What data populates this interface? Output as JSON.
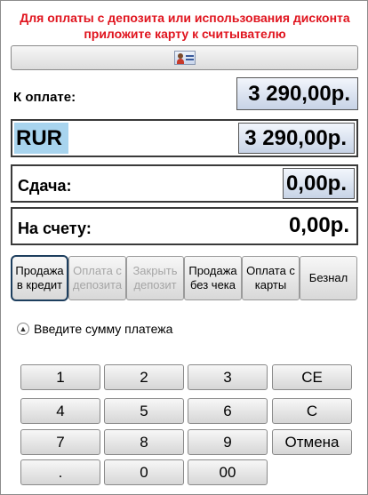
{
  "notice": {
    "line1": "Для оплаты с депозита или использования дисконта",
    "line2": "приложите карту к считывателю"
  },
  "card_button": {
    "icon": "id-card-icon"
  },
  "payment": {
    "due_label": "К оплате:",
    "due_value": "3 290,00р.",
    "currency": "RUR",
    "currency_value": "3 290,00р.",
    "change_label": "Сдача:",
    "change_value": "0,00р.",
    "account_label": "На счету:",
    "account_value": "0,00р."
  },
  "actions": [
    {
      "label": "Продажа в кредит",
      "state": "selected"
    },
    {
      "label": "Оплата с депозита",
      "state": "disabled"
    },
    {
      "label": "Закрыть депозит",
      "state": "disabled"
    },
    {
      "label": "Продажа без чека",
      "state": "enabled"
    },
    {
      "label": "Оплата с карты",
      "state": "enabled"
    },
    {
      "label": "Безнал",
      "state": "enabled"
    }
  ],
  "hint": {
    "text": "Введите сумму платежа",
    "icon": "chevron-up-circle-icon"
  },
  "keypad": {
    "k1": "1",
    "k2": "2",
    "k3": "3",
    "ce": "CE",
    "k4": "4",
    "k5": "5",
    "k6": "6",
    "c": "C",
    "k7": "7",
    "k8": "8",
    "k9": "9",
    "cancel": "Отмена",
    "dot": ".",
    "k0": "0",
    "k00": "00"
  },
  "colors": {
    "notice": "#e0141e",
    "currency_highlight": "#a8d4ee",
    "value_field": "#c7d3e6",
    "selected_border": "#1d3e5e",
    "disabled_text": "#a6a6a6"
  }
}
